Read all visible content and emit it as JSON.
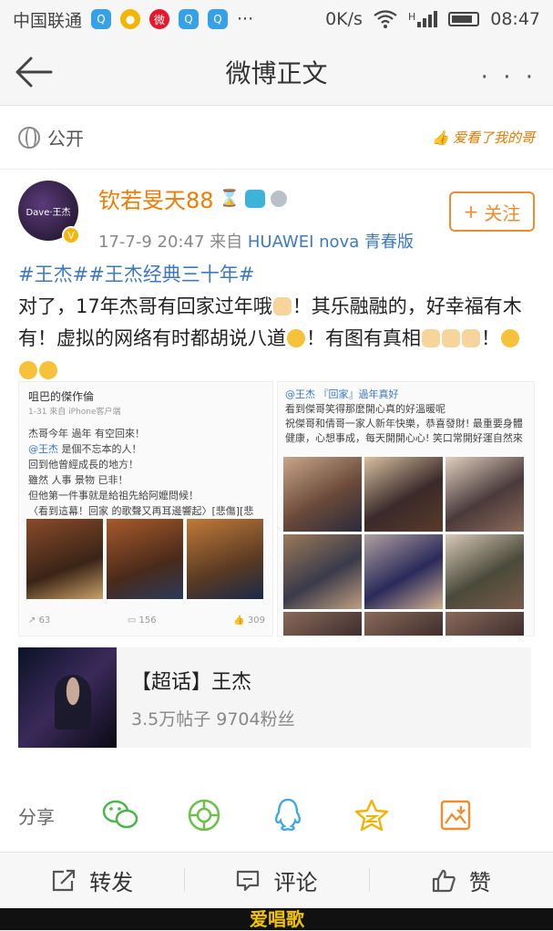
{
  "status_bar": {
    "carrier": "中国联通",
    "speed": "0K/s",
    "network": "H",
    "time": "08:47",
    "notification_icons": [
      "qq-icon",
      "game-icon",
      "weibo-icon",
      "qq-icon",
      "qq-icon"
    ],
    "more": "···"
  },
  "nav": {
    "title": "微博正文",
    "more": "· · ·"
  },
  "visibility": {
    "label": "公开",
    "sticker_text": "爱看了我的哥"
  },
  "author": {
    "name": "钦若旻天88",
    "avatar_text": "Dave·王杰",
    "date": "17-7-9 20:47",
    "source_prefix": "来自",
    "source": "HUAWEI nova 青春版",
    "follow_label": "关注",
    "follow_icon": "+"
  },
  "post": {
    "hashtags": "#王杰##王杰经典三十年#",
    "text_1": "对了，17年杰哥有回家过年哦",
    "text_2": "！其乐融融的，好幸福有木有！虚拟的网络有时都胡说八道",
    "text_3": "！有图有真相",
    "text_4": "！"
  },
  "image_left": {
    "user": "咀巴的傑作倫",
    "time": "1-31  來自 iPhone客户端",
    "line1": "杰哥今年 過年 有空回來！",
    "mention": "@王杰",
    "line2": " 是個不忘本的人！",
    "line3": "回到他曾經成長的地方！",
    "line4": "雖然 人事 景物 已非！",
    "line5": "但他第一件事就是給祖先給阿嬤問候！",
    "line6": "〈看到這幕！回家 的歌聲又再耳邊響起〉[悲傷][悲傷]",
    "reposts": "63",
    "comments": "156",
    "likes": "309"
  },
  "image_right": {
    "header": "@王杰 『回家』過年真好",
    "line1": "看到傑哥笑得那麼開心真的好溫暖呢",
    "line2": "祝傑哥和倩哥一家人新年快樂，恭喜發財! 最重要身體健康，心想事成，每天開開心心! 笑口常開好運自然來"
  },
  "topic": {
    "title": "【超话】王杰",
    "stats": "3.5万帖子 9704粉丝"
  },
  "share": {
    "label": "分享",
    "targets": [
      "wechat-icon",
      "moments-icon",
      "qq-icon",
      "qzone-icon",
      "save-image-icon"
    ]
  },
  "actions": {
    "repost": "转发",
    "comment": "评论",
    "like": "赞"
  },
  "watermark": "爱唱歌",
  "colors": {
    "accent_orange": "#ef7b00",
    "link_blue": "#3c79c2",
    "follow_border": "#f28b2f"
  }
}
